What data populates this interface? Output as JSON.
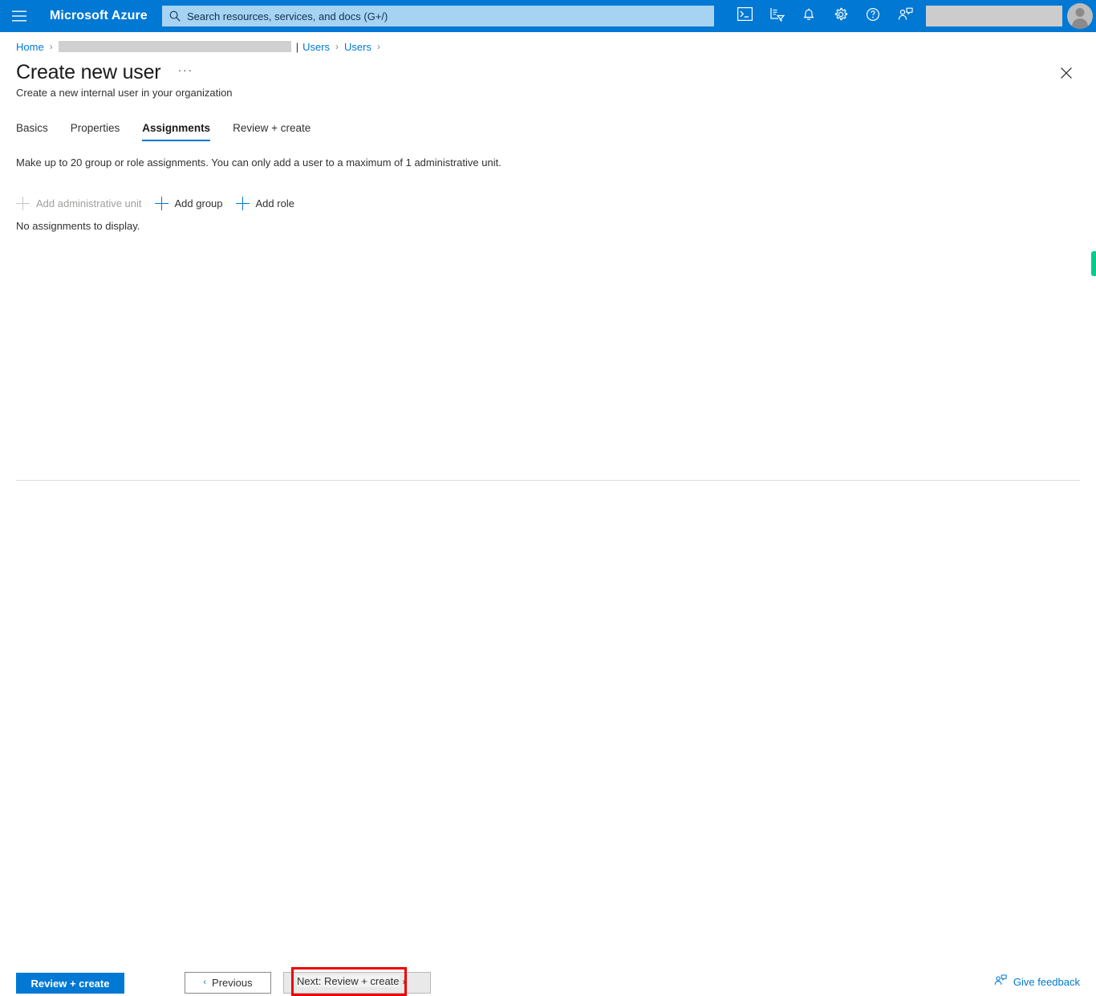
{
  "topbar": {
    "brand": "Microsoft Azure",
    "menu_icon": "hamburger-icon",
    "search": {
      "placeholder": "Search resources, services, and docs (G+/)",
      "value": "",
      "icon": "search-icon"
    },
    "icons": [
      {
        "name": "cloud-shell-icon",
        "title": "Cloud Shell"
      },
      {
        "name": "directory-filter-icon",
        "title": "Directories + subscriptions"
      },
      {
        "name": "notifications-bell-icon",
        "title": "Notifications"
      },
      {
        "name": "settings-gear-icon",
        "title": "Settings"
      },
      {
        "name": "help-question-icon",
        "title": "Help"
      },
      {
        "name": "feedback-person-icon",
        "title": "Feedback"
      }
    ],
    "account_redacted": true,
    "avatar_icon": "user-avatar"
  },
  "breadcrumb": {
    "home": "Home",
    "redacted": true,
    "pipe": "|",
    "items": [
      "Users",
      "Users"
    ]
  },
  "header": {
    "title": "Create new user",
    "ellipsis": "···",
    "subtitle": "Create a new internal user in your organization",
    "close_icon": "close-icon"
  },
  "tabs": [
    {
      "label": "Basics",
      "active": false
    },
    {
      "label": "Properties",
      "active": false
    },
    {
      "label": "Assignments",
      "active": true
    },
    {
      "label": "Review + create",
      "active": false
    }
  ],
  "content": {
    "helper_text": "Make up to 20 group or role assignments. You can only add a user to a maximum of 1 administrative unit.",
    "commands": [
      {
        "label": "Add administrative unit",
        "icon": "plus-icon",
        "disabled": true
      },
      {
        "label": "Add group",
        "icon": "plus-icon",
        "disabled": false
      },
      {
        "label": "Add role",
        "icon": "plus-icon",
        "disabled": false
      }
    ],
    "empty_message": "No assignments to display."
  },
  "footer": {
    "review_create": "Review + create",
    "previous": "Previous",
    "previous_chevron": "‹",
    "next": "Next: Review + create",
    "next_chevron": "›",
    "feedback": "Give feedback",
    "feedback_icon": "feedback-person-icon"
  },
  "annotations": {
    "highlight_target": "Next: Review + create",
    "highlight_color": "#ee0000",
    "edge_marker_color": "#00cc8e"
  },
  "colors": {
    "azure_blue": "#0078d4",
    "search_bg": "#a6d3f2",
    "text": "#323130",
    "disabled": "#a19f9d"
  }
}
